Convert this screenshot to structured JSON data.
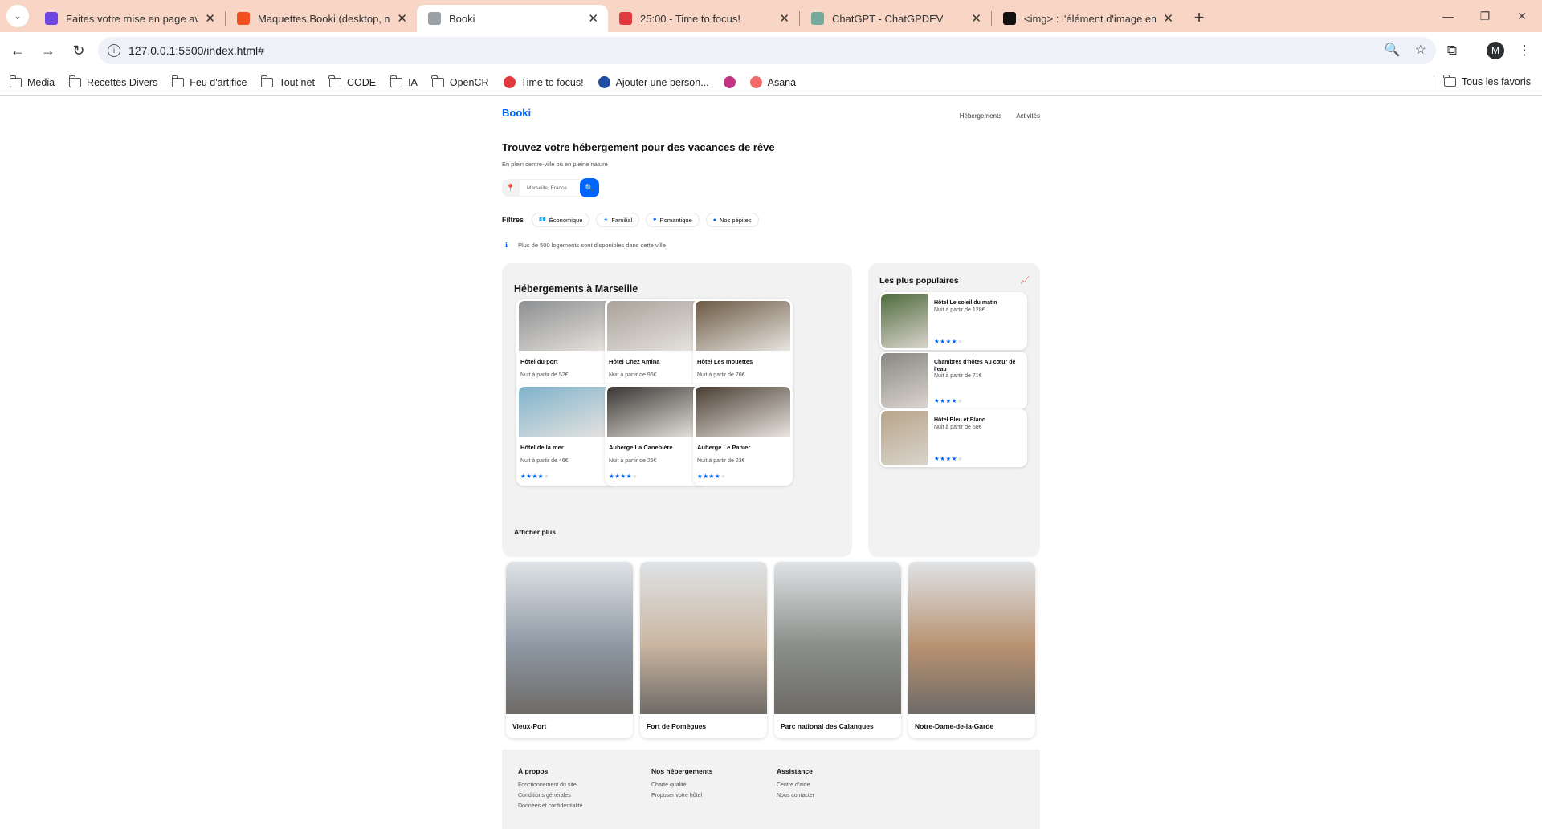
{
  "browser": {
    "tabs": [
      {
        "title": "Faites votre mise en page avec",
        "favicon_color": "#6b46e0"
      },
      {
        "title": "Maquettes Booki (desktop, mo",
        "favicon_color": "#f24e1e"
      },
      {
        "title": "Booki",
        "favicon_color": "#9aa0a6",
        "active": true
      },
      {
        "title": "25:00 - Time to focus!",
        "favicon_color": "#e03a3e"
      },
      {
        "title": "ChatGPT - ChatGPDEV",
        "favicon_color": "#74aa9c"
      },
      {
        "title": "<img> : l'élément d'image em",
        "favicon_color": "#111111"
      }
    ],
    "url": "127.0.0.1:5500/index.html#",
    "avatar_letter": "M",
    "bookmarks": [
      {
        "label": "Media",
        "type": "folder"
      },
      {
        "label": "Recettes Divers",
        "type": "folder"
      },
      {
        "label": "Feu d'artifice",
        "type": "folder"
      },
      {
        "label": "Tout net",
        "type": "folder"
      },
      {
        "label": "CODE",
        "type": "folder"
      },
      {
        "label": "IA",
        "type": "folder"
      },
      {
        "label": "OpenCR",
        "type": "folder"
      },
      {
        "label": "Time to focus!",
        "type": "site",
        "color": "#e03a3e"
      },
      {
        "label": "Ajouter une person...",
        "type": "site",
        "color": "#1f4fa0"
      },
      {
        "label": "",
        "type": "site",
        "color": "#c13584"
      },
      {
        "label": "Asana",
        "type": "site",
        "color": "#f06a6a"
      }
    ],
    "all_bookmarks": "Tous les favoris"
  },
  "site": {
    "logo": "Booki",
    "nav": [
      "Hébergements",
      "Activités"
    ],
    "headline": "Trouvez votre hébergement pour des vacances de rêve",
    "subtitle": "En plein centre-ville ou en pleine nature",
    "search_placeholder": "Marseille, France",
    "filters_label": "Filtres",
    "filters": [
      {
        "label": "Économique",
        "icon": "money-icon"
      },
      {
        "label": "Familial",
        "icon": "child-icon"
      },
      {
        "label": "Romantique",
        "icon": "heart-icon"
      },
      {
        "label": "Nos pépites",
        "icon": "dog-icon"
      }
    ],
    "notice": "Plus de 500 logements sont disponibles dans cette ville",
    "accent": "#0065fc",
    "hebergements": {
      "title": "Hébergements à Marseille",
      "more": "Afficher plus",
      "items": [
        {
          "name": "Hôtel du port",
          "price": "Nuit à partir de 52€",
          "rating": 4,
          "img": "#8d8f91"
        },
        {
          "name": "Hôtel Chez Amina",
          "price": "Nuit à partir de 96€",
          "rating": 4,
          "img": "#a8a29a"
        },
        {
          "name": "Hôtel Les mouettes",
          "price": "Nuit à partir de 76€",
          "rating": 4,
          "img": "#6b5a45"
        },
        {
          "name": "Hôtel de la mer",
          "price": "Nuit à partir de 46€",
          "rating": 4,
          "img": "#7fb3cc"
        },
        {
          "name": "Auberge La Canebière",
          "price": "Nuit à partir de 25€",
          "rating": 4,
          "img": "#3a3633"
        },
        {
          "name": "Auberge Le Panier",
          "price": "Nuit à partir de 23€",
          "rating": 4,
          "img": "#4a3e33"
        }
      ]
    },
    "populaires": {
      "title": "Les plus populaires",
      "items": [
        {
          "name": "Hôtel Le soleil du matin",
          "price": "Nuit à partir de 128€",
          "rating": 4,
          "img": "#4f6b3d"
        },
        {
          "name": "Chambres d'hôtes Au cœur de l'eau",
          "price": "Nuit à partir de 71€",
          "rating": 4,
          "img": "#8a8784"
        },
        {
          "name": "Hôtel Bleu et Blanc",
          "price": "Nuit à partir de 68€",
          "rating": 4,
          "img": "#b8a58a"
        }
      ]
    },
    "activites": [
      {
        "name": "Vieux-Port",
        "img": "#8e98a4"
      },
      {
        "name": "Fort de Pomègues",
        "img": "#c9b5a0"
      },
      {
        "name": "Parc national des Calanques",
        "img": "#8a8f8a"
      },
      {
        "name": "Notre-Dame-de-la-Garde",
        "img": "#b99272"
      }
    ],
    "footer": [
      {
        "heading": "À propos",
        "links": [
          "Fonctionnement du site",
          "Conditions générales",
          "Données et confidentialité"
        ]
      },
      {
        "heading": "Nos hébergements",
        "links": [
          "Charte qualité",
          "Proposer votre hôtel"
        ]
      },
      {
        "heading": "Assistance",
        "links": [
          "Centre d'aide",
          "Nous contacter"
        ]
      }
    ]
  }
}
